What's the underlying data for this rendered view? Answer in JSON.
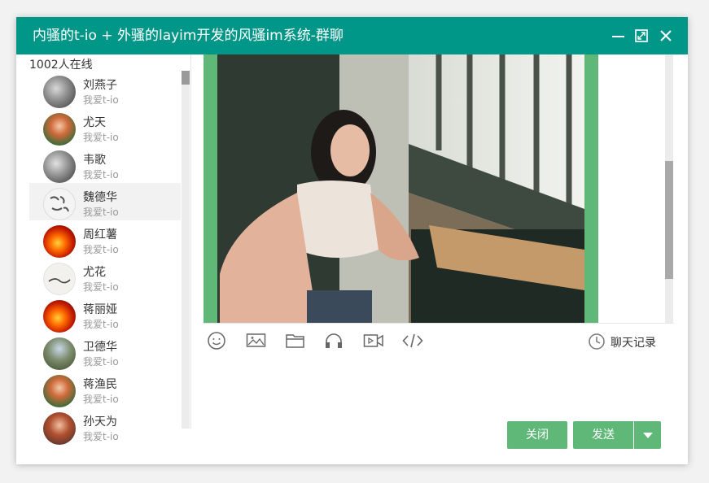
{
  "window": {
    "title": "内骚的t-io + 外骚的layim开发的风骚im系统-群聊",
    "accent": "#009688"
  },
  "sidebar": {
    "online_count": "1002人在线",
    "members": [
      {
        "name": "刘燕子",
        "sign": "我爱t-io"
      },
      {
        "name": "尤天",
        "sign": "我爱t-io"
      },
      {
        "name": "韦歌",
        "sign": "我爱t-io"
      },
      {
        "name": "魏德华",
        "sign": "我爱t-io"
      },
      {
        "name": "周红薯",
        "sign": "我爱t-io"
      },
      {
        "name": "尤花",
        "sign": "我爱t-io"
      },
      {
        "name": "蒋丽娅",
        "sign": "我爱t-io"
      },
      {
        "name": "卫德华",
        "sign": "我爱t-io"
      },
      {
        "name": "蒋渔民",
        "sign": "我爱t-io"
      },
      {
        "name": "孙天为",
        "sign": "我爱t-io"
      }
    ]
  },
  "toolbar": {
    "icons": [
      "smile-icon",
      "image-icon",
      "folder-icon",
      "headphones-icon",
      "video-icon",
      "code-icon"
    ],
    "history_label": "聊天记录"
  },
  "footer": {
    "close_label": "关闭",
    "send_label": "发送",
    "button_color": "#5fb878"
  }
}
